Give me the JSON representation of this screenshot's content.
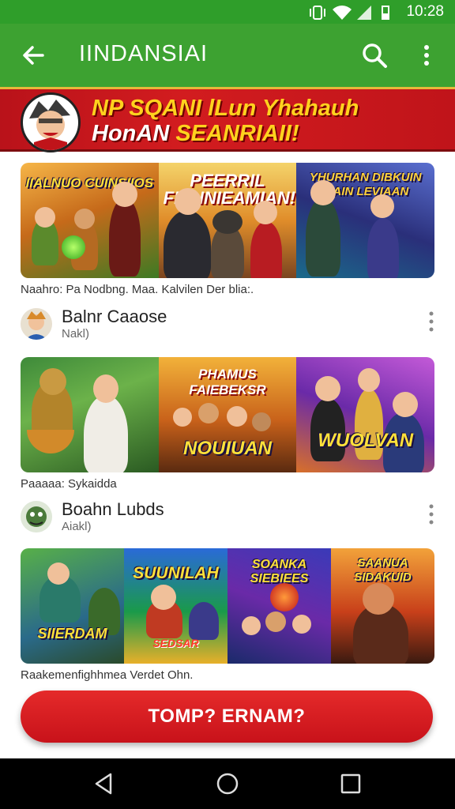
{
  "status": {
    "time": "10:28"
  },
  "appbar": {
    "title": "IINDANSIAI"
  },
  "banner": {
    "line1": "NP SQANI lLun Yhahauh",
    "line2_a": "HonAN ",
    "line2_b": "SEANRIAII!"
  },
  "sections": [
    {
      "panel_titles": [
        "IIALNUO CUINSIIOS",
        "PEERRIL FIANNIEAMIAN!",
        "YHURHAN DIBKUIN FIAIN LEVIAAN"
      ],
      "caption": "Naahro: Pa Nodbng. Maa.  Kalvilen Der blia:.",
      "item": {
        "name": "Balnr Caaose",
        "sub": "Nakl)"
      }
    },
    {
      "panel_titles": [
        "PHAMUS FAIEBEKSR",
        "NOUIUAN",
        "WUOLVAN"
      ],
      "caption": "Paaaaa: Sykaidda",
      "item": {
        "name": "Boahn Lubds",
        "sub": "Aiakl)"
      }
    },
    {
      "panel_titles": [
        "SIIERDAM",
        "SUUNILAH",
        "SOANKA SIEBIEES",
        "SAANUA SIDAKUID"
      ],
      "caption": "Raakemenfighhmea Verdet Ohn."
    }
  ],
  "cta": {
    "label": "TOMP? ERNAM?"
  },
  "colors": {
    "appbar": "#3da231",
    "banner": "#d21c1f",
    "cta": "#d81c22",
    "accent_yellow": "#ffd21e"
  }
}
